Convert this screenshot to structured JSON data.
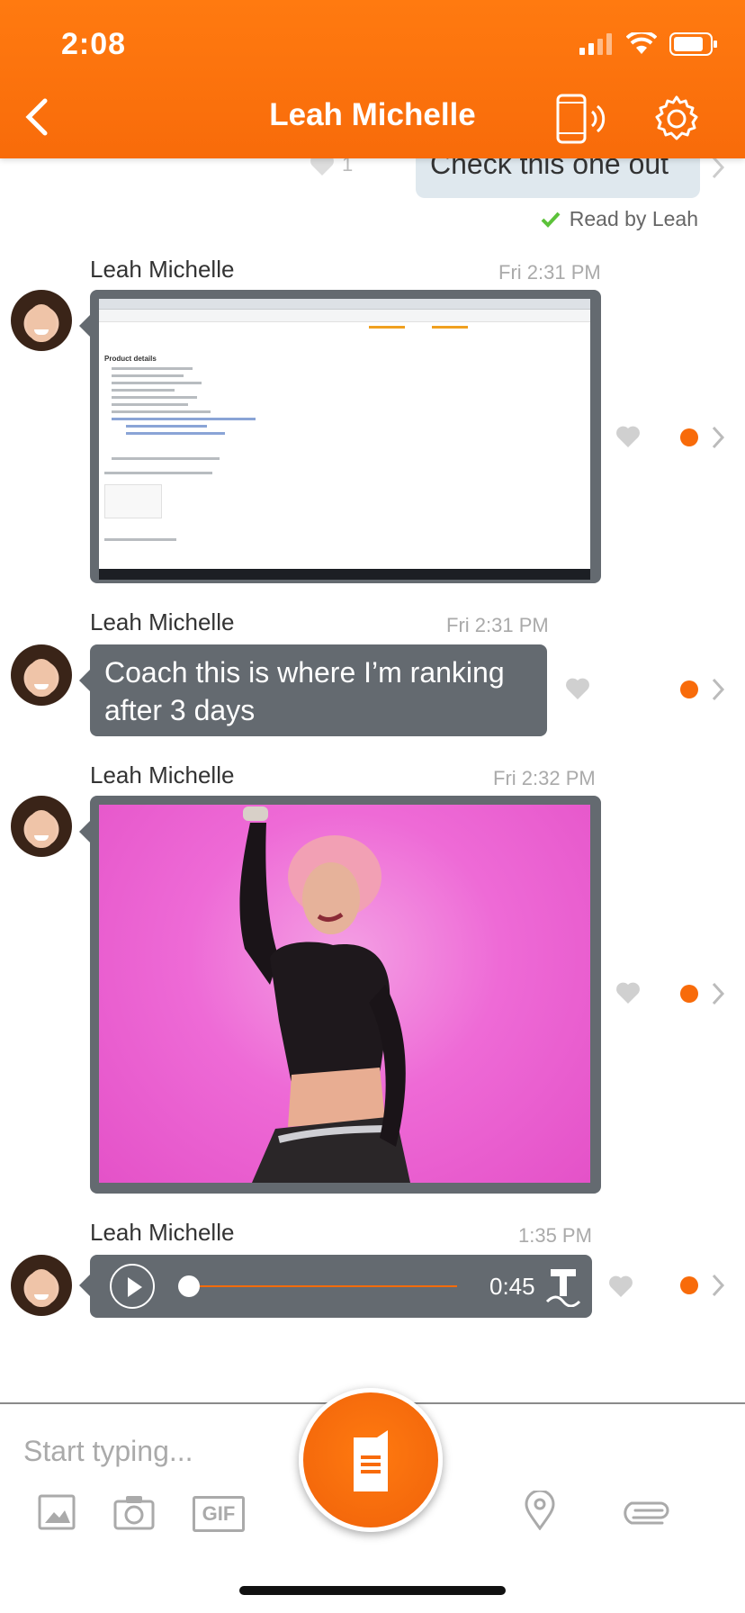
{
  "status_bar": {
    "time": "2:08"
  },
  "header": {
    "title": "Leah Michelle"
  },
  "outgoing": {
    "text": "Check this one out",
    "heart_count": "1",
    "read_receipt": "Read by Leah"
  },
  "messages": [
    {
      "sender": "Leah Michelle",
      "timestamp": "Fri 2:31 PM",
      "type": "image",
      "image_heading": "Product details"
    },
    {
      "sender": "Leah Michelle",
      "timestamp": "Fri 2:31 PM",
      "type": "text",
      "text": "Coach this is where I’m ranking after 3 days"
    },
    {
      "sender": "Leah Michelle",
      "timestamp": "Fri 2:32 PM",
      "type": "gif"
    },
    {
      "sender": "Leah Michelle",
      "timestamp": "1:35 PM",
      "type": "audio",
      "duration": "0:45"
    }
  ],
  "composer": {
    "placeholder": "Start typing...",
    "gif_label": "GIF"
  },
  "colors": {
    "accent": "#f86b0a",
    "bubble_dark": "#646a70",
    "bubble_light": "#dfe8ee",
    "read_check": "#5cc23a"
  },
  "icons": [
    "back-chevron-icon",
    "phone-icon",
    "gear-icon",
    "heart-icon",
    "unread-dot-icon",
    "chevron-right-icon",
    "play-icon",
    "transcribe-icon",
    "image-icon",
    "camera-icon",
    "gif-icon",
    "location-pin-icon",
    "paperclip-icon",
    "notepad-icon"
  ]
}
